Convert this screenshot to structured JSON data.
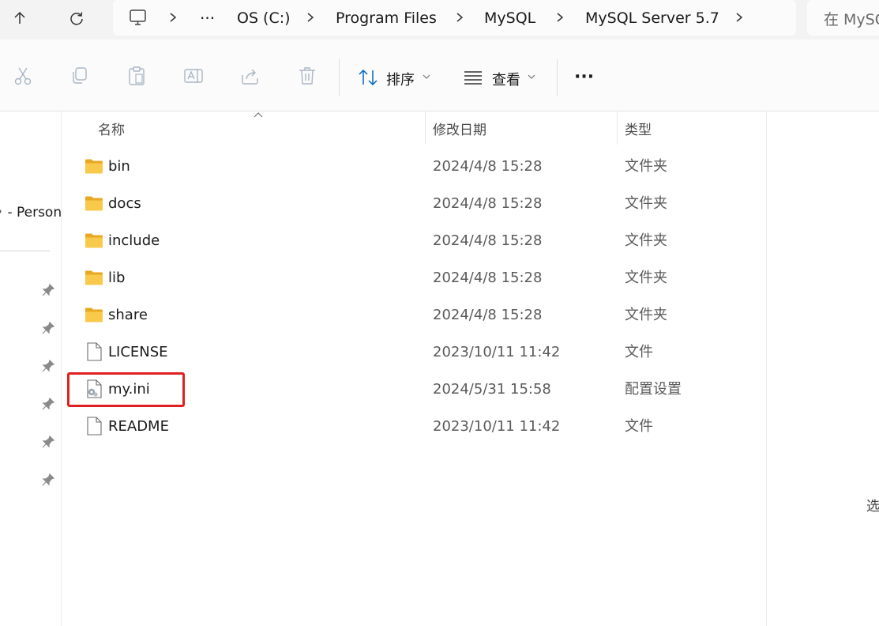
{
  "address": {
    "overflow": "···",
    "crumbs": [
      "OS (C:)",
      "Program Files",
      "MySQL",
      "MySQL Server 5.7"
    ],
    "search_placeholder": "在 MySQL"
  },
  "commands": {
    "sort_label": "排序",
    "view_label": "查看",
    "more_label": "···"
  },
  "nav": {
    "onedrive_label": "- Personal"
  },
  "columns": {
    "name": "名称",
    "date": "修改日期",
    "type": "类型"
  },
  "files": [
    {
      "name": "bin",
      "date": "2024/4/8 15:28",
      "type": "文件夹",
      "icon": "folder-icon"
    },
    {
      "name": "docs",
      "date": "2024/4/8 15:28",
      "type": "文件夹",
      "icon": "folder-icon"
    },
    {
      "name": "include",
      "date": "2024/4/8 15:28",
      "type": "文件夹",
      "icon": "folder-icon"
    },
    {
      "name": "lib",
      "date": "2024/4/8 15:28",
      "type": "文件夹",
      "icon": "folder-icon"
    },
    {
      "name": "share",
      "date": "2024/4/8 15:28",
      "type": "文件夹",
      "icon": "folder-icon"
    },
    {
      "name": "LICENSE",
      "date": "2023/10/11 11:42",
      "type": "文件",
      "icon": "file-icon"
    },
    {
      "name": "my.ini",
      "date": "2024/5/31 15:58",
      "type": "配置设置",
      "icon": "config-file-icon"
    },
    {
      "name": "README",
      "date": "2023/10/11 11:42",
      "type": "文件",
      "icon": "file-icon"
    }
  ],
  "details_pane_text": "选",
  "colors": {
    "highlight": "#e02020",
    "folder": "#f5c33b",
    "accent": "#0067c0"
  }
}
